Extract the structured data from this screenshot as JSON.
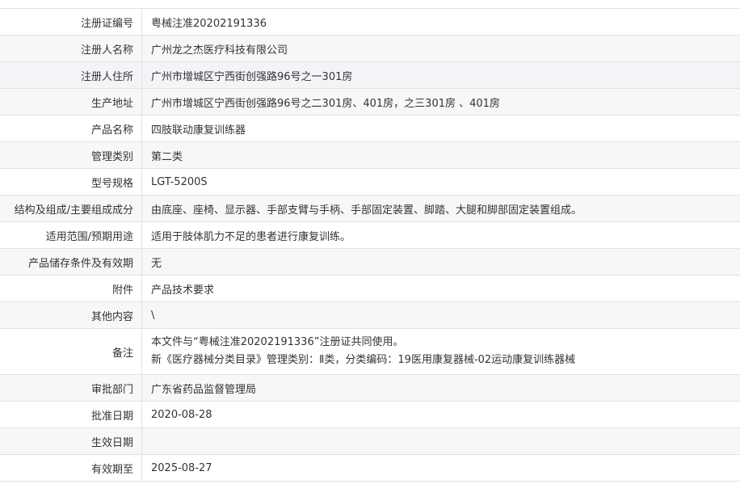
{
  "rows": [
    {
      "label": "注册证编号",
      "value": "粤械注准20202191336"
    },
    {
      "label": "注册人名称",
      "value": "广州龙之杰医疗科技有限公司"
    },
    {
      "label": "注册人住所",
      "value": "广州市增城区宁西街创强路96号之一301房"
    },
    {
      "label": "生产地址",
      "value": "广州市增城区宁西街创强路96号之二301房、401房，之三301房 、401房"
    },
    {
      "label": "产品名称",
      "value": "四肢联动康复训练器"
    },
    {
      "label": "管理类别",
      "value": "第二类"
    },
    {
      "label": "型号规格",
      "value": "LGT-5200S"
    },
    {
      "label": "结构及组成/主要组成成分",
      "value": "由底座、座椅、显示器、手部支臂与手柄、手部固定装置、脚踏、大腿和脚部固定装置组成。"
    },
    {
      "label": "适用范围/预期用途",
      "value": "适用于肢体肌力不足的患者进行康复训练。"
    },
    {
      "label": "产品储存条件及有效期",
      "value": "无"
    },
    {
      "label": "附件",
      "value": "产品技术要求"
    },
    {
      "label": "其他内容",
      "value": "\\"
    },
    {
      "label": "备注",
      "line1": "本文件与“粤械注准20202191336”注册证共同使用。",
      "line2": "新《医疗器械分类目录》管理类别：Ⅱ类，分类编码：19医用康复器械-02运动康复训练器械"
    },
    {
      "label": "审批部门",
      "value": "广东省药品监督管理局"
    },
    {
      "label": "批准日期",
      "value": "2020-08-28"
    },
    {
      "label": "生效日期",
      "value": ""
    },
    {
      "label": "有效期至",
      "value": "2025-08-27"
    }
  ]
}
